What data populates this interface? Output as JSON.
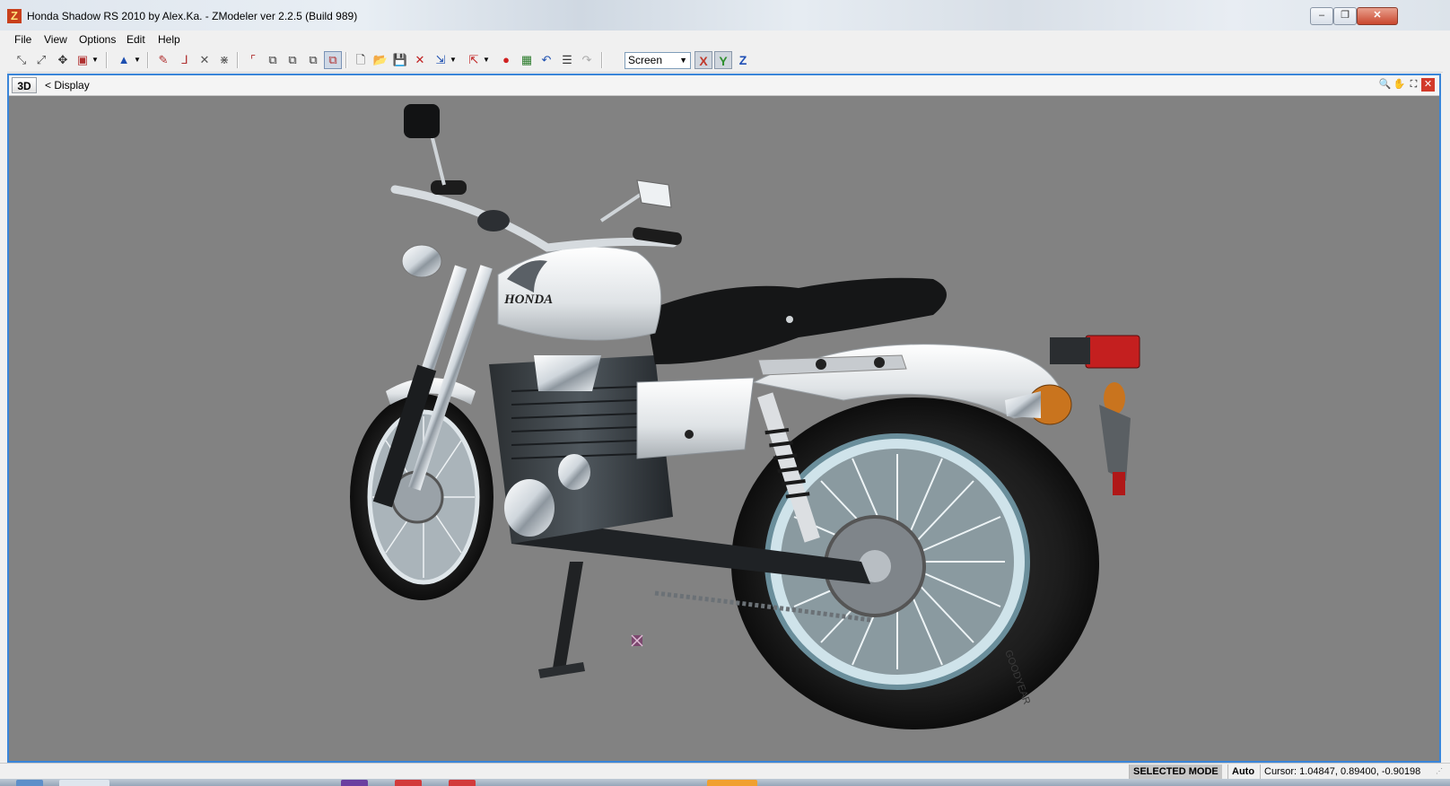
{
  "window": {
    "title": "Honda Shadow RS  2010 by Alex.Ka. - ZModeler ver 2.2.5 (Build 989)",
    "app_icon": "Z",
    "minimize": "–",
    "restore": "❐",
    "close": "✕"
  },
  "menu": [
    "File",
    "View",
    "Options",
    "Edit",
    "Help"
  ],
  "toolbar": {
    "coordinate_space": "Screen",
    "axes": [
      "X",
      "Y",
      "Z"
    ],
    "icons": [
      "select-icon",
      "vertex-select-icon",
      "move-icon",
      "scale-icon",
      "dropdown-icon",
      "pyramid-icon",
      "dropdown-icon",
      "pick-icon",
      "axis-icon",
      "cross-icon",
      "multi-axis-icon",
      "fit-icon",
      "box1-icon",
      "box2-icon",
      "box3-icon",
      "box4-icon",
      "new-file-icon",
      "open-file-icon",
      "save-icon",
      "delete-icon",
      "import-icon",
      "dropdown-icon",
      "export-icon",
      "dropdown-icon",
      "render-icon",
      "texture-icon",
      "undo-icon",
      "notes-icon",
      "redo-icon"
    ]
  },
  "viewport": {
    "mode_button": "3D",
    "label": "<  Display",
    "tools": [
      "zoom-icon",
      "pan-icon",
      "fullscreen-icon",
      "close-view-icon"
    ],
    "model": {
      "brand": "HONDA",
      "tire_text": "GOODYEAR"
    }
  },
  "status": {
    "mode": "SELECTED MODE",
    "auto": "Auto",
    "cursor": "Cursor: 1.04847, 0.89400, -0.90198"
  },
  "colors": {
    "viewport_bg": "#828282",
    "viewport_border": "#3a85d9",
    "axis_x": "#c0392b",
    "axis_y": "#2f8f2f",
    "axis_z": "#1f4fb5"
  }
}
